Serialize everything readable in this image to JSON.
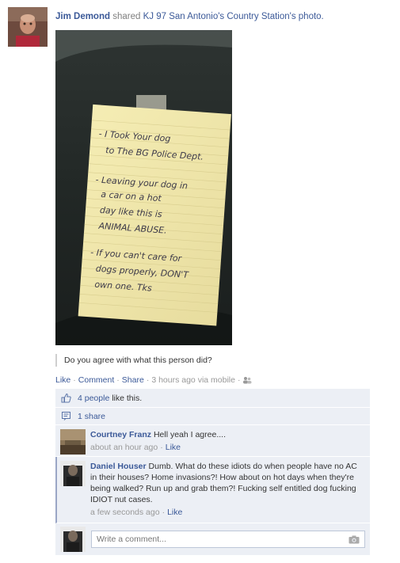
{
  "story": {
    "actor": "Jim Demond",
    "verb": "shared",
    "page": "KJ 97 San Antonio's Country Station",
    "object": "'s photo."
  },
  "photo": {
    "note_lines": [
      "- I Took Your dog",
      "to The BG Police Dept.",
      "- Leaving your dog in",
      "a car on a hot",
      "day like this is",
      "ANIMAL ABUSE.",
      "- If you can't care for",
      "dogs properly, DON'T",
      "own one. Tks"
    ]
  },
  "caption": "Do you agree with what this person did?",
  "actions": {
    "like": "Like",
    "comment": "Comment",
    "share": "Share",
    "time": "3 hours ago via mobile"
  },
  "likes": {
    "count": "4 people",
    "suffix": " like this."
  },
  "shares": {
    "label": "1 share"
  },
  "comments": [
    {
      "author": "Courtney Franz",
      "text": "Hell yeah I agree....",
      "time": "about an hour ago",
      "like": "Like"
    },
    {
      "author": "Daniel Houser",
      "text": "Dumb. What do these idiots do when people have no AC in their houses? Home invasions?! How about on hot days when they're being walked? Run up and grab them?! Fucking self entitled dog fucking IDIOT nut cases.",
      "time": "a few seconds ago",
      "like": "Like"
    }
  ],
  "composer": {
    "placeholder": "Write a comment..."
  }
}
